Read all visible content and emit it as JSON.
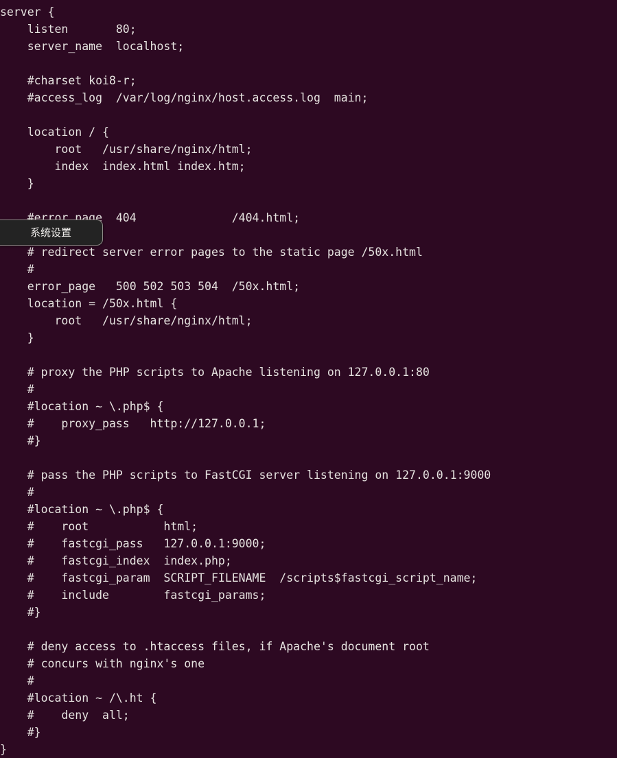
{
  "terminal": {
    "background_color": "#2d0922",
    "text_color": "#e6e3e0",
    "file_content_lines": [
      "server {",
      "    listen       80;",
      "    server_name  localhost;",
      "",
      "    #charset koi8-r;",
      "    #access_log  /var/log/nginx/host.access.log  main;",
      "",
      "    location / {",
      "        root   /usr/share/nginx/html;",
      "        index  index.html index.htm;",
      "    }",
      "",
      "    #error_page  404              /404.html;",
      "",
      "    # redirect server error pages to the static page /50x.html",
      "    #",
      "    error_page   500 502 503 504  /50x.html;",
      "    location = /50x.html {",
      "        root   /usr/share/nginx/html;",
      "    }",
      "",
      "    # proxy the PHP scripts to Apache listening on 127.0.0.1:80",
      "    #",
      "    #location ~ \\.php$ {",
      "    #    proxy_pass   http://127.0.0.1;",
      "    #}",
      "",
      "    # pass the PHP scripts to FastCGI server listening on 127.0.0.1:9000",
      "    #",
      "    #location ~ \\.php$ {",
      "    #    root           html;",
      "    #    fastcgi_pass   127.0.0.1:9000;",
      "    #    fastcgi_index  index.php;",
      "    #    fastcgi_param  SCRIPT_FILENAME  /scripts$fastcgi_script_name;",
      "    #    include        fastcgi_params;",
      "    #}",
      "",
      "    # deny access to .htaccess files, if Apache's document root",
      "    # concurs with nginx's one",
      "    #",
      "    #location ~ /\\.ht {",
      "    #    deny  all;",
      "    #}",
      "}"
    ]
  },
  "tooltip": {
    "label": "系统设置",
    "background_color": "#232323",
    "border_color": "#8e8b88",
    "text_color": "#f2f0ee"
  }
}
